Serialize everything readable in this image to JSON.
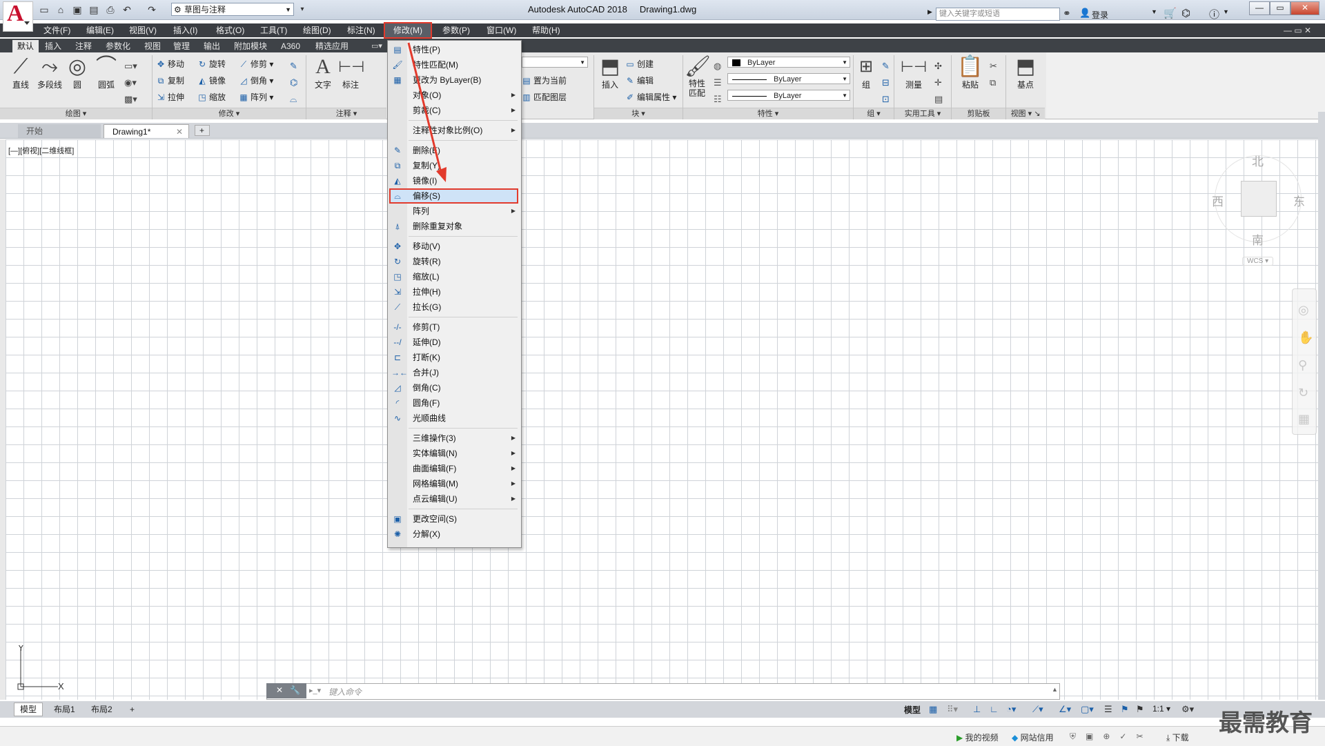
{
  "app": {
    "title": "Autodesk AutoCAD 2018",
    "drawing": "Drawing1.dwg",
    "logo": "A",
    "workspace": "草图与注释",
    "search_placeholder": "键入关键字或短语",
    "login": "登录"
  },
  "menubar": [
    "文件(F)",
    "编辑(E)",
    "视图(V)",
    "插入(I)",
    "格式(O)",
    "工具(T)",
    "绘图(D)",
    "标注(N)",
    "修改(M)",
    "参数(P)",
    "窗口(W)",
    "帮助(H)"
  ],
  "ribbon_tabs": [
    "默认",
    "插入",
    "注释",
    "参数化",
    "视图",
    "管理",
    "输出",
    "附加模块",
    "A360",
    "精选应用"
  ],
  "ribbon": {
    "draw": {
      "title": "绘图",
      "buttons": [
        "直线",
        "多段线",
        "圆",
        "圆弧"
      ]
    },
    "modify": {
      "title": "修改",
      "rows": [
        [
          "移动",
          "旋转",
          "修剪"
        ],
        [
          "复制",
          "镜像",
          "倒角"
        ],
        [
          "拉伸",
          "缩放",
          "阵列"
        ]
      ]
    },
    "annotation": {
      "title": "注释",
      "buttons": [
        "文字",
        "标注"
      ]
    },
    "layers": {
      "set_current": "置为当前",
      "match_layer": "匹配图层"
    },
    "block": {
      "title": "块",
      "insert": "插入",
      "create": "创建",
      "edit": "编辑",
      "edit_attr": "编辑属性"
    },
    "properties": {
      "title": "特性",
      "match": "特性\n匹配",
      "color": "ByLayer",
      "linetype": "ByLayer",
      "lineweight": "ByLayer"
    },
    "groups": {
      "title": "组",
      "group": "组"
    },
    "utilities": {
      "title": "实用工具",
      "measure": "测量"
    },
    "clipboard": {
      "title": "剪贴板",
      "paste": "粘贴"
    },
    "view": {
      "title": "视图",
      "base": "基点"
    }
  },
  "file_tabs": {
    "start": "开始",
    "drawing": "Drawing1*",
    "add": "+"
  },
  "viewport_label": "[—][俯视][二维线框]",
  "viewcube": {
    "north": "北",
    "south": "南",
    "east": "东",
    "west": "西",
    "wcs": "WCS"
  },
  "command_placeholder": "键入命令",
  "layout_tabs": [
    "模型",
    "布局1",
    "布局2"
  ],
  "status": {
    "model": "模型",
    "scale": "1:1"
  },
  "taskbar": {
    "video": "我的视频",
    "netcredit": "网站信用",
    "download": "下载"
  },
  "watermark": "最需教育",
  "modify_menu": [
    {
      "label": "特性(P)",
      "icon": "properties-icon",
      "glyph": "▤"
    },
    {
      "label": "特性匹配(M)",
      "icon": "match-properties-icon",
      "glyph": "🖌"
    },
    {
      "label": "更改为 ByLayer(B)",
      "icon": "bylayer-icon",
      "glyph": "▦"
    },
    {
      "label": "对象(O)",
      "icon": "",
      "glyph": "",
      "submenu": true
    },
    {
      "label": "剪裁(C)",
      "icon": "",
      "glyph": "",
      "submenu": true
    },
    {
      "sep": true
    },
    {
      "label": "注释性对象比例(O)",
      "icon": "",
      "glyph": "",
      "submenu": true
    },
    {
      "sep": true
    },
    {
      "label": "删除(E)",
      "icon": "erase-icon",
      "glyph": "✎"
    },
    {
      "label": "复制(Y)",
      "icon": "copy-icon",
      "glyph": "⧉"
    },
    {
      "label": "镜像(I)",
      "icon": "mirror-icon",
      "glyph": "◭"
    },
    {
      "label": "偏移(S)",
      "icon": "offset-icon",
      "glyph": "⌓",
      "highlight": true
    },
    {
      "label": "阵列",
      "icon": "",
      "glyph": "",
      "submenu": true
    },
    {
      "label": "删除重复对象",
      "icon": "overkill-icon",
      "glyph": "⍋"
    },
    {
      "sep": true
    },
    {
      "label": "移动(V)",
      "icon": "move-icon",
      "glyph": "✥"
    },
    {
      "label": "旋转(R)",
      "icon": "rotate-icon",
      "glyph": "↻"
    },
    {
      "label": "缩放(L)",
      "icon": "scale-icon",
      "glyph": "◳"
    },
    {
      "label": "拉伸(H)",
      "icon": "stretch-icon",
      "glyph": "⇲"
    },
    {
      "label": "拉长(G)",
      "icon": "lengthen-icon",
      "glyph": "⟋"
    },
    {
      "sep": true
    },
    {
      "label": "修剪(T)",
      "icon": "trim-icon",
      "glyph": "-/-"
    },
    {
      "label": "延伸(D)",
      "icon": "extend-icon",
      "glyph": "--/"
    },
    {
      "label": "打断(K)",
      "icon": "break-icon",
      "glyph": "⊏"
    },
    {
      "label": "合并(J)",
      "icon": "join-icon",
      "glyph": "→←"
    },
    {
      "label": "倒角(C)",
      "icon": "chamfer-icon",
      "glyph": "◿"
    },
    {
      "label": "圆角(F)",
      "icon": "fillet-icon",
      "glyph": "◜"
    },
    {
      "label": "光顺曲线",
      "icon": "blend-curve-icon",
      "glyph": "∿"
    },
    {
      "sep": true
    },
    {
      "label": "三维操作(3)",
      "icon": "",
      "glyph": "",
      "submenu": true
    },
    {
      "label": "实体编辑(N)",
      "icon": "",
      "glyph": "",
      "submenu": true
    },
    {
      "label": "曲面编辑(F)",
      "icon": "",
      "glyph": "",
      "submenu": true
    },
    {
      "label": "网格编辑(M)",
      "icon": "",
      "glyph": "",
      "submenu": true
    },
    {
      "label": "点云编辑(U)",
      "icon": "",
      "glyph": "",
      "submenu": true
    },
    {
      "sep": true
    },
    {
      "label": "更改空间(S)",
      "icon": "change-space-icon",
      "glyph": "▣"
    },
    {
      "label": "分解(X)",
      "icon": "explode-icon",
      "glyph": "✺"
    }
  ],
  "colors": {
    "accent_red": "#e23a2c",
    "menubar": "#3a3d42",
    "icon_blue": "#1b5fa8"
  }
}
